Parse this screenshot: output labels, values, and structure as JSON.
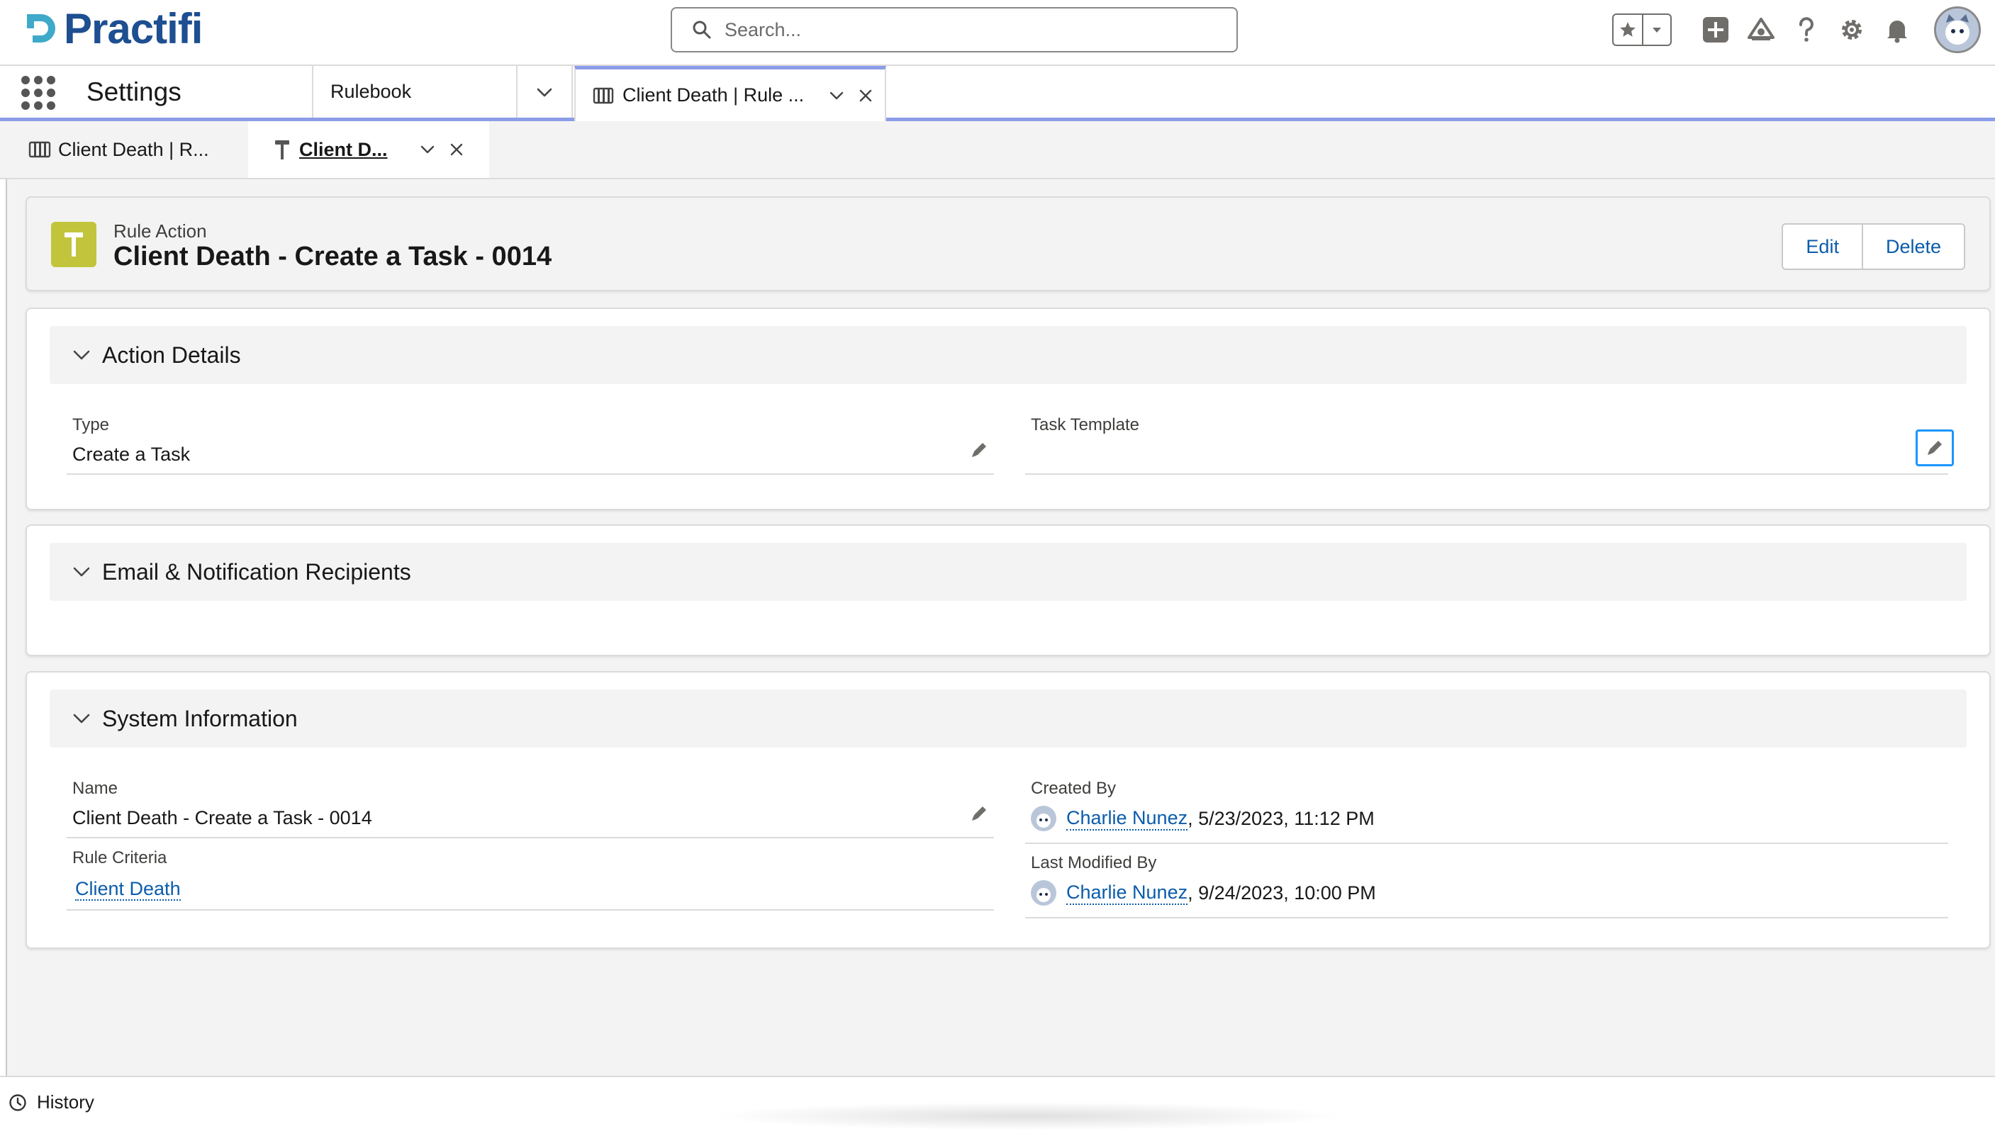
{
  "brand": {
    "name": "Practifi",
    "color": "#1d4f91"
  },
  "search": {
    "placeholder": "Search..."
  },
  "header_icons": [
    "favorites-star-icon",
    "add-icon",
    "trailhead-icon",
    "help-icon",
    "setup-gear-icon",
    "notifications-bell-icon",
    "user-avatar"
  ],
  "nav": {
    "app_name": "Settings",
    "items": [
      {
        "label": "Rulebook"
      },
      {
        "label": "Client Death | Rule ..."
      }
    ]
  },
  "subtabs": [
    {
      "label": "Client Death | R..."
    },
    {
      "label": "Client D..."
    }
  ],
  "record": {
    "object_type": "Rule Action",
    "title": "Client Death - Create a Task - 0014",
    "actions": {
      "edit": "Edit",
      "delete": "Delete"
    }
  },
  "sections": {
    "action_details": {
      "title": "Action Details",
      "type_label": "Type",
      "type_value": "Create a Task",
      "task_template_label": "Task Template",
      "task_template_value": ""
    },
    "recipients": {
      "title": "Email & Notification Recipients"
    },
    "system_info": {
      "title": "System Information",
      "name_label": "Name",
      "name_value": "Client Death - Create a Task - 0014",
      "rule_criteria_label": "Rule Criteria",
      "rule_criteria_value": "Client Death",
      "created_by_label": "Created By",
      "created_by_user": "Charlie Nunez",
      "created_by_date": ", 5/23/2023, 11:12 PM",
      "modified_by_label": "Last Modified By",
      "modified_by_user": "Charlie Nunez",
      "modified_by_date": ", 9/24/2023, 10:00 PM"
    }
  },
  "footer": {
    "history_label": "History"
  },
  "colors": {
    "accent": "#8b9ce8",
    "link": "#0b5cab",
    "record_icon": "#c2c53b",
    "focus_outline": "#1b96ff"
  }
}
